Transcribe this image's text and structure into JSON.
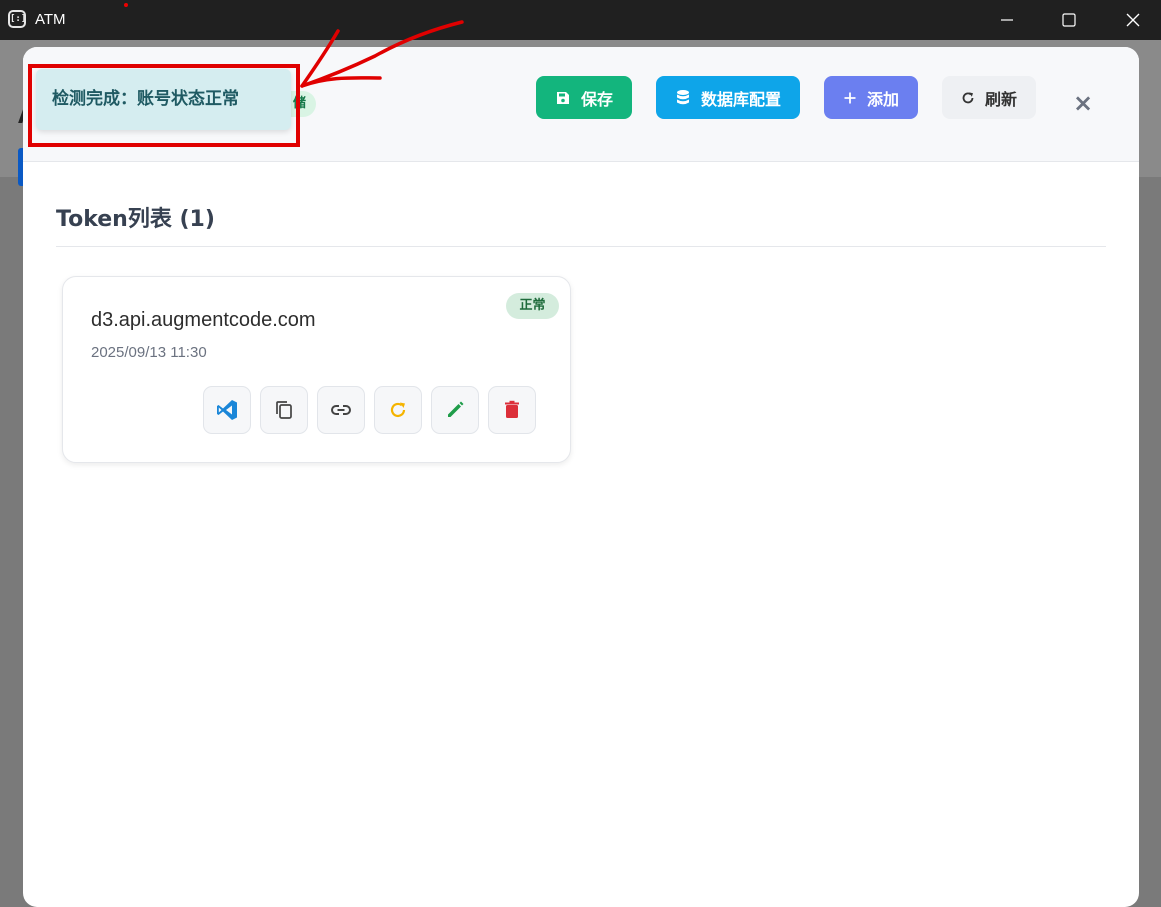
{
  "window": {
    "title": "ATM",
    "app_icon": "[:]"
  },
  "background": {
    "partial_letter": "A"
  },
  "header": {
    "storage_badge": "储",
    "buttons": {
      "save": "保存",
      "db_config": "数据库配置",
      "add": "添加",
      "refresh": "刷新"
    },
    "close": "×"
  },
  "section": {
    "title": "Token列表 (1)"
  },
  "tokens": [
    {
      "domain": "d3.api.augmentcode.com",
      "date": "2025/09/13 11:30",
      "status": "正常"
    }
  ],
  "toast": {
    "message": "检测完成：账号状态正常"
  },
  "colors": {
    "save": "#13b57d",
    "db_config": "#0ea5e9",
    "add": "#6b7ff0",
    "status_ok": "#d4ecdd",
    "annotation": "#e00000"
  }
}
